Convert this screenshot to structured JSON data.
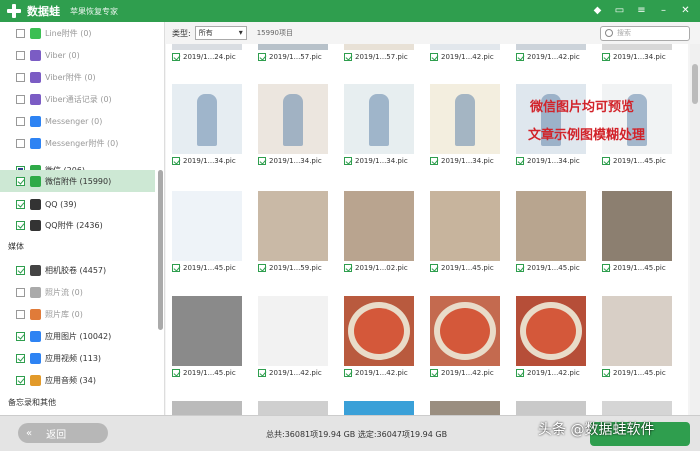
{
  "app": {
    "name": "数据蛙",
    "subtitle": "苹果恢复专家"
  },
  "sidebar": {
    "items": [
      {
        "label": "Line附件 (0)",
        "dim": true,
        "check": "off",
        "icon": "line-icon",
        "color": "#3bbf53"
      },
      {
        "label": "Viber (0)",
        "dim": true,
        "check": "off",
        "icon": "viber-icon",
        "color": "#7b5cc4"
      },
      {
        "label": "Viber附件 (0)",
        "dim": true,
        "check": "off",
        "icon": "viber-icon",
        "color": "#7b5cc4"
      },
      {
        "label": "Viber通话记录 (0)",
        "dim": true,
        "check": "off",
        "icon": "viber-icon",
        "color": "#7b5cc4"
      },
      {
        "label": "Messenger (0)",
        "dim": true,
        "check": "off",
        "icon": "messenger-icon",
        "color": "#2e83f3"
      },
      {
        "label": "Messenger附件 (0)",
        "dim": true,
        "check": "off",
        "icon": "messenger-icon",
        "color": "#2e83f3"
      },
      {
        "label": "微信 (206)",
        "dim": false,
        "check": "part",
        "icon": "wechat-icon",
        "color": "#2faa48"
      },
      {
        "label": "微信附件 (15990)",
        "dim": false,
        "check": "on",
        "icon": "wechat-icon",
        "color": "#2faa48",
        "selected": true
      },
      {
        "label": "QQ (39)",
        "dim": false,
        "check": "on",
        "icon": "qq-icon",
        "color": "#333"
      },
      {
        "label": "QQ附件 (2436)",
        "dim": false,
        "check": "on",
        "icon": "qq-icon",
        "color": "#333"
      },
      {
        "label": "相机胶卷 (4457)",
        "dim": false,
        "check": "on",
        "icon": "camera-icon",
        "color": "#444"
      },
      {
        "label": "照片流 (0)",
        "dim": true,
        "check": "off",
        "icon": "photostream-icon",
        "color": "#aaa"
      },
      {
        "label": "照片库 (0)",
        "dim": true,
        "check": "off",
        "icon": "photolibrary-icon",
        "color": "#e07b39"
      },
      {
        "label": "应用图片 (10042)",
        "dim": false,
        "check": "on",
        "icon": "app-photo-icon",
        "color": "#2e83f3"
      },
      {
        "label": "应用视频 (113)",
        "dim": false,
        "check": "on",
        "icon": "app-video-icon",
        "color": "#2e83f3"
      },
      {
        "label": "应用音频 (34)",
        "dim": false,
        "check": "on",
        "icon": "app-audio-icon",
        "color": "#e29a2a"
      }
    ],
    "section_media": "媒体",
    "section_memo": "备忘录和其他"
  },
  "toolbar": {
    "type_label": "类型:",
    "type_value": "所有",
    "count": "15990项目",
    "search_placeholder": "搜索"
  },
  "grid": {
    "rows": [
      {
        "caps": [
          "2019/1...24.pic",
          "2019/1...57.pic",
          "2019/1...57.pic",
          "2019/1...42.pic",
          "2019/1...42.pic",
          "2019/1...34.pic"
        ]
      },
      {
        "caps": [
          "2019/1...34.pic",
          "2019/1...34.pic",
          "2019/1...34.pic",
          "2019/1...34.pic",
          "2019/1...34.pic",
          "2019/1...45.pic"
        ]
      },
      {
        "caps": [
          "2019/1...45.pic",
          "2019/1...59.pic",
          "2019/1...02.pic",
          "2019/1...45.pic",
          "2019/1...45.pic",
          "2019/1...45.pic"
        ]
      },
      {
        "caps": [
          "2019/1...45.pic",
          "2019/1...42.pic",
          "2019/1...42.pic",
          "2019/1...42.pic",
          "2019/1...42.pic",
          "2019/1...45.pic"
        ]
      }
    ],
    "overlay_line1": "微信图片均可预览",
    "overlay_line2": "文章示例图模糊处理"
  },
  "bottom": {
    "back_label": "返回",
    "totals": "总共:36081项19.94 GB 选定:36047项19.94 GB"
  },
  "watermark": {
    "text": "头条 @数据蛙软件"
  },
  "colors": {
    "brand": "#2f9e4e",
    "selected_row": "#cde8d4",
    "overlay_text": "#d2232a"
  }
}
